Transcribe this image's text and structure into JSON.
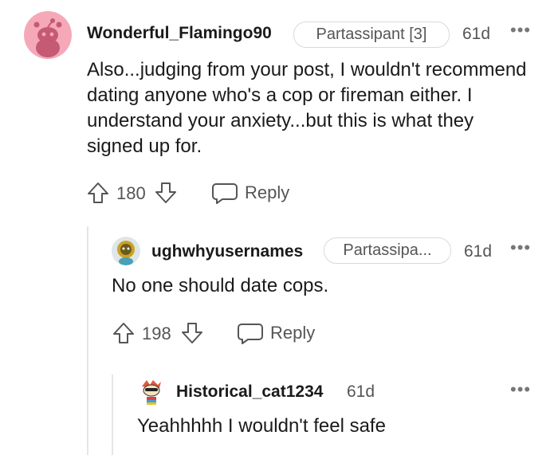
{
  "comments": [
    {
      "username": "Wonderful_Flamingo90",
      "flair": "Partassipant [3]",
      "age": "61d",
      "body": "Also...judging from your post, I wouldn't recommend dating anyone who's a cop or fireman either. I understand your anxiety...but this is what they signed up for.",
      "votes": "180",
      "reply_label": "Reply"
    },
    {
      "username": "ughwhyusernames",
      "flair": "Partassipa...",
      "age": "61d",
      "body": "No one should date cops.",
      "votes": "198",
      "reply_label": "Reply"
    },
    {
      "username": "Historical_cat1234",
      "age": "61d",
      "body": "Yeahhhhh I wouldn't feel safe"
    }
  ],
  "more_icon": "more-options-icon",
  "colors": {
    "avatar_pink": "#f5a9b8",
    "text": "#1a1a1b",
    "muted": "#555555"
  }
}
